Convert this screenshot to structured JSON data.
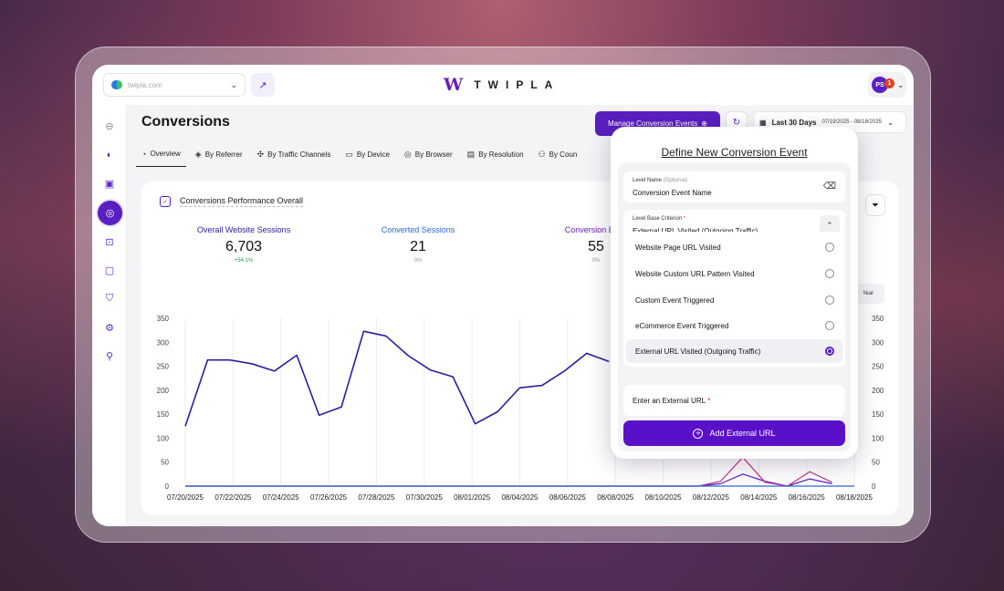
{
  "colors": {
    "brand": "#5a1fc0",
    "accent": "#6a1fb0",
    "line": "#2a1fa0",
    "pink": "#c0308a",
    "green": "#2e9a4a"
  },
  "header": {
    "site_url": "twipla.com",
    "logo_mark": "W",
    "logo_text": "TWIPLA",
    "avatar_initials": "PS",
    "notification_count": "1"
  },
  "sidebar": {
    "items": [
      {
        "icon": "collapse-icon"
      },
      {
        "icon": "globe-icon"
      },
      {
        "icon": "inbox-icon"
      },
      {
        "icon": "target-icon",
        "active": true
      },
      {
        "icon": "scan-icon"
      },
      {
        "icon": "chat-icon"
      },
      {
        "icon": "shield-icon"
      },
      {
        "icon": "gear-icon"
      },
      {
        "icon": "location-icon"
      }
    ]
  },
  "page": {
    "title": "Conversions",
    "manage_button": "Manage Conversion Events",
    "date_label": "Last 30 Days",
    "date_range": "07/19/2025 - 08/18/2025"
  },
  "tabs": [
    {
      "label": "Overview",
      "icon": "◔",
      "active": true
    },
    {
      "label": "By Referrer",
      "icon": "◈"
    },
    {
      "label": "By Traffic Channels",
      "icon": "✣"
    },
    {
      "label": "By Device",
      "icon": "▭"
    },
    {
      "label": "By Browser",
      "icon": "◎"
    },
    {
      "label": "By Resolution",
      "icon": "▤"
    },
    {
      "label": "By Coun",
      "icon": "⚇"
    }
  ],
  "card": {
    "title": "Conversions Performance Overall",
    "year_button": "Year",
    "kpis": [
      {
        "label": "Overall Website Sessions",
        "value": "6,703",
        "delta": "+54.1%",
        "color": "#2a1fa0",
        "delta_color": "#2e9a4a"
      },
      {
        "label": "Converted Sessions",
        "value": "21",
        "delta": "0%",
        "color": "#2a6ad0",
        "delta_color": "#999"
      },
      {
        "label": "Conversion Even",
        "value": "55",
        "delta": "0%",
        "color": "#6a1fb0",
        "delta_color": "#999"
      }
    ]
  },
  "chart_data": {
    "type": "line",
    "y_ticks": [
      "0",
      "50",
      "100",
      "150",
      "200",
      "250",
      "300",
      "350"
    ],
    "ylim": [
      0,
      350
    ],
    "x_labels": [
      "07/20/2025",
      "07/22/2025",
      "07/24/2025",
      "07/26/2025",
      "07/28/2025",
      "07/30/2025",
      "08/01/2025",
      "08/04/2025",
      "08/06/2025",
      "08/08/2025",
      "08/10/2025",
      "08/12/2025",
      "08/14/2025",
      "08/16/2025",
      "08/18/2025"
    ],
    "series": [
      {
        "values": [
          125,
          263,
          263,
          255,
          240,
          273,
          148,
          165,
          323,
          313,
          272,
          242,
          228,
          130,
          155,
          205,
          210,
          240,
          277,
          260
        ]
      },
      {
        "values": [
          0,
          0,
          0,
          0,
          0,
          0,
          0,
          0,
          0,
          0,
          0,
          0,
          0,
          0,
          0,
          0,
          0,
          0,
          0,
          0,
          0,
          0,
          0,
          0,
          5,
          25,
          10,
          0,
          15,
          5
        ]
      },
      {
        "values": [
          0,
          0,
          0,
          0,
          0,
          0,
          0,
          0,
          0,
          0,
          0,
          0,
          0,
          0,
          0,
          0,
          0,
          0,
          0,
          0,
          0,
          0,
          0,
          0,
          10,
          60,
          8,
          0,
          30,
          8
        ]
      }
    ]
  },
  "popup": {
    "title": "Define New Conversion Event",
    "level_name_label": "Level Name",
    "level_name_optional": "(Optional)",
    "level_name_value": "Conversion Event Name",
    "criterion_label": "Level Base Criterion",
    "required_mark": "*",
    "criterion_value": "External URL Visited (Outgoing Traffic)",
    "options": [
      {
        "label": "Website Page URL Visited",
        "selected": false
      },
      {
        "label": "Website Custom URL Pattern Visited",
        "selected": false
      },
      {
        "label": "Custom Event Triggered",
        "selected": false
      },
      {
        "label": "eCommerce Event Triggered",
        "selected": false
      },
      {
        "label": "External URL Visited (Outgoing Traffic)",
        "selected": true
      }
    ],
    "url_label": "Enter an External URL",
    "add_button": "Add External URL"
  }
}
